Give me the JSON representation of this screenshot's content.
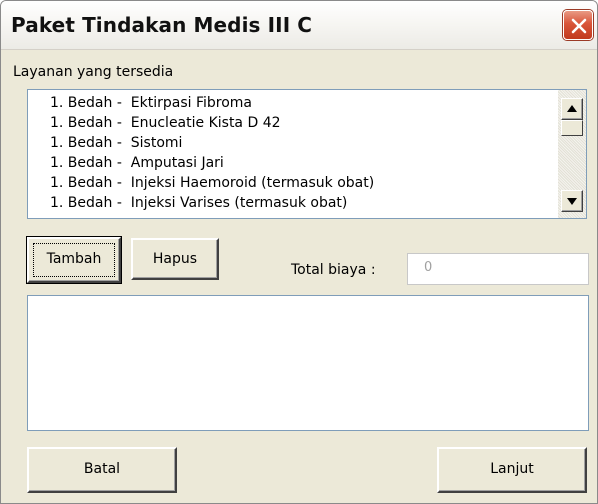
{
  "window": {
    "title": "Paket Tindakan Medis III C"
  },
  "available": {
    "label": "Layanan yang tersedia",
    "items": [
      "1. Bedah -  Ektirpasi Fibroma",
      "1. Bedah -  Enucleatie Kista D 42",
      "1. Bedah -  Sistomi",
      "1. Bedah -  Amputasi Jari",
      "1. Bedah -  Injeksi Haemoroid (termasuk obat)",
      "1. Bedah -  Injeksi Varises (termasuk obat)"
    ]
  },
  "buttons": {
    "add": "Tambah",
    "remove": "Hapus",
    "cancel": "Batal",
    "next": "Lanjut"
  },
  "total": {
    "label": "Total biaya :",
    "value": "0"
  },
  "icons": {
    "close": "close-icon",
    "scroll_up": "arrow-up-icon",
    "scroll_down": "arrow-down-icon"
  },
  "colors": {
    "titlebar_close": "#d9553a",
    "dialog_bg": "#ece9d8",
    "listbox_border": "#7f9db9"
  }
}
